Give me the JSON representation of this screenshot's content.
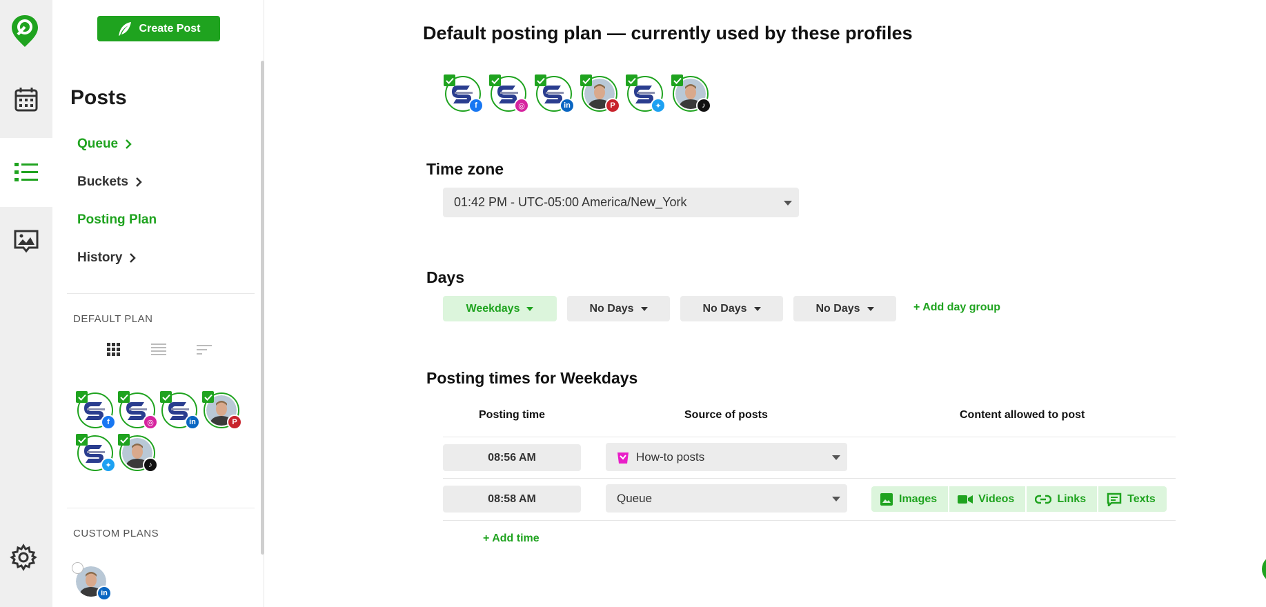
{
  "theme": {
    "accent": "#1fa31f",
    "accent_light": "#dcf5dc",
    "rail_bg": "#efefef"
  },
  "rail": {
    "icons": [
      "app-logo-icon",
      "calendar-icon",
      "list-icon",
      "media-icon",
      "gear-icon"
    ]
  },
  "sidebar": {
    "create_post": "Create Post",
    "title": "Posts",
    "nav": {
      "queue": "Queue",
      "buckets": "Buckets",
      "posting_plan": "Posting Plan",
      "history": "History"
    },
    "default_plan_label": "DEFAULT PLAN",
    "custom_plans_label": "CUSTOM PLANS",
    "default_profiles": [
      {
        "type": "logo",
        "network": "facebook",
        "checked": true
      },
      {
        "type": "logo",
        "network": "instagram",
        "checked": true
      },
      {
        "type": "logo",
        "network": "linkedin",
        "checked": true
      },
      {
        "type": "person",
        "network": "pinterest",
        "checked": true
      },
      {
        "type": "logo",
        "network": "twitter",
        "checked": true
      },
      {
        "type": "person",
        "network": "tiktok",
        "checked": true
      }
    ],
    "custom_profiles": [
      {
        "type": "person",
        "network": "linkedin",
        "checked": false
      }
    ]
  },
  "main": {
    "title": "Default posting plan — currently used by these profiles",
    "profiles": [
      {
        "type": "logo",
        "network": "facebook",
        "checked": true
      },
      {
        "type": "logo",
        "network": "instagram",
        "checked": true
      },
      {
        "type": "logo",
        "network": "linkedin",
        "checked": true
      },
      {
        "type": "person",
        "network": "pinterest",
        "checked": true
      },
      {
        "type": "logo",
        "network": "twitter",
        "checked": true
      },
      {
        "type": "person",
        "network": "tiktok",
        "checked": true
      }
    ],
    "timezone": {
      "heading": "Time zone",
      "value": "01:42 PM - UTC-05:00 America/New_York"
    },
    "days": {
      "heading": "Days",
      "groups": [
        "Weekdays",
        "No Days",
        "No Days",
        "No Days"
      ],
      "add_label": "+ Add day group"
    },
    "posting_times": {
      "heading": "Posting times for Weekdays",
      "columns": [
        "Posting time",
        "Source of posts",
        "Content allowed to post"
      ],
      "rows": [
        {
          "time": "08:56 AM",
          "source": "How-to posts",
          "content": []
        },
        {
          "time": "08:58 AM",
          "source": "Queue",
          "content": [
            "Images",
            "Videos",
            "Links",
            "Texts"
          ]
        }
      ],
      "add_time": "+ Add time"
    }
  }
}
